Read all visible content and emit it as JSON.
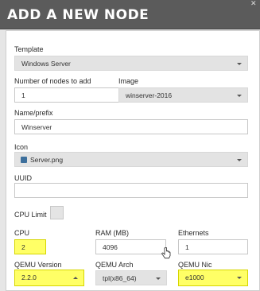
{
  "dialog": {
    "title": "ADD A NEW NODE"
  },
  "template": {
    "label": "Template",
    "value": "Windows Server"
  },
  "nodes": {
    "label": "Number of nodes to add",
    "value": "1"
  },
  "image": {
    "label": "Image",
    "value": "winserver-2016"
  },
  "name": {
    "label": "Name/prefix",
    "value": "Winserver"
  },
  "icon": {
    "label": "Icon",
    "value": "Server.png"
  },
  "uuid": {
    "label": "UUID",
    "value": ""
  },
  "cpu_limit": {
    "label": "CPU Limit"
  },
  "cpu": {
    "label": "CPU",
    "value": "2"
  },
  "ram": {
    "label": "RAM (MB)",
    "value": "4096"
  },
  "ethernets": {
    "label": "Ethernets",
    "value": "1"
  },
  "qemu_version": {
    "label": "QEMU Version",
    "value": "2.2.0"
  },
  "qemu_arch": {
    "label": "QEMU Arch",
    "value": "tpl(x86_64)"
  },
  "qemu_nic": {
    "label": "QEMU Nic",
    "value": "e1000"
  },
  "colors": {
    "header": "#5b5b5b",
    "highlight": "#ffff66",
    "select_bg": "#e3e3e3"
  }
}
